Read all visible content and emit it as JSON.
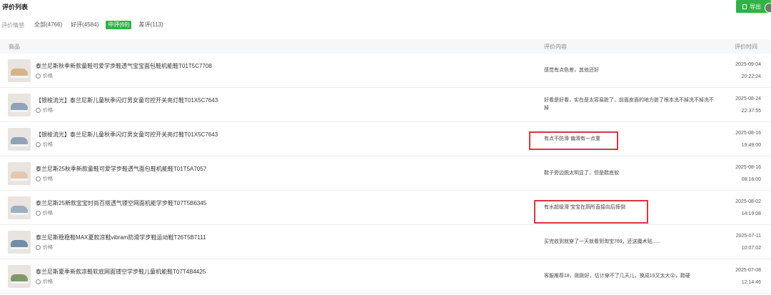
{
  "header": {
    "title": "评价列表",
    "export_label": "导出"
  },
  "filters": {
    "label": "评价情感",
    "tabs": [
      {
        "label": "全部(4766)"
      },
      {
        "label": "好评(4584)"
      },
      {
        "label": "中评(69)"
      },
      {
        "label": "差评(113)"
      }
    ]
  },
  "table": {
    "columns": {
      "product": "商品",
      "content": "评价内容",
      "time": "评价时间"
    },
    "price_label": "价格",
    "rows": [
      {
        "name": "泰兰尼斯秋季新款童鞋可爱学步鞋透气宝宝面包鞋机能鞋T01T5C7708",
        "content": "感觉有点色差，其他还好",
        "date": "2025-09-04",
        "time": "20:22:24",
        "shoe_color": "#d7b38a"
      },
      {
        "name": "【银梭流光】泰兰尼斯儿童秋季闪灯男女童可控开关亮灯鞋T01X5C7643",
        "content": "好看是好看，实在是太容易脏了，前面皮面的地方脏了根本洗不掉洗不掉洗不掉",
        "date": "2025-08-24",
        "time": "22:37:55",
        "shoe_color": "#8fa3b8"
      },
      {
        "name": "【银梭流光】泰兰尼斯儿童秋季闪灯男女童可控开关亮灯鞋T01X5C7643",
        "content": "有点不防滑 偏滑有一点重",
        "date": "2025-08-16",
        "time": "19:49:00",
        "shoe_color": "#8fa3b8"
      },
      {
        "name": "泰兰尼斯25秋季新款童鞋可爱学步鞋透气面包鞋机能鞋T01T5A7057",
        "content": "鞋子旁边脱太明显了，但是鞋底软",
        "date": "2025-08-16",
        "time": "08:16:00",
        "shoe_color": "#e6c6b0"
      },
      {
        "name": "泰兰尼斯25新款宝宝时尚百搭透气镂空网面机能学步鞋T07T5B6345",
        "content": "有水超级滑 宝宝在厕所直接向后摔倒",
        "date": "2025-08-02",
        "time": "14:19:08",
        "shoe_color": "#9cb0c2"
      },
      {
        "name": "泰兰尼斯稳稳鞋MAX夏款凉鞋vibram防滑学步鞋运动鞋T26T5B7111",
        "content": "买完收到就穿了一天就看到淘宝769，还送魔术贴......",
        "date": "2025-07-11",
        "time": "10:07:02",
        "shoe_color": "#6f8fa6"
      },
      {
        "name": "泰兰尼斯夏季新款凉鞋软底网面镂空学步鞋儿童机能鞋T07T4B4425",
        "content": "客服推荐18，刚刚好，估计穿不了几天儿，换成19又太大😮，鞋硬",
        "date": "2025-07-08",
        "time": "12:14:46",
        "shoe_color": "#7d9a6a"
      }
    ]
  }
}
